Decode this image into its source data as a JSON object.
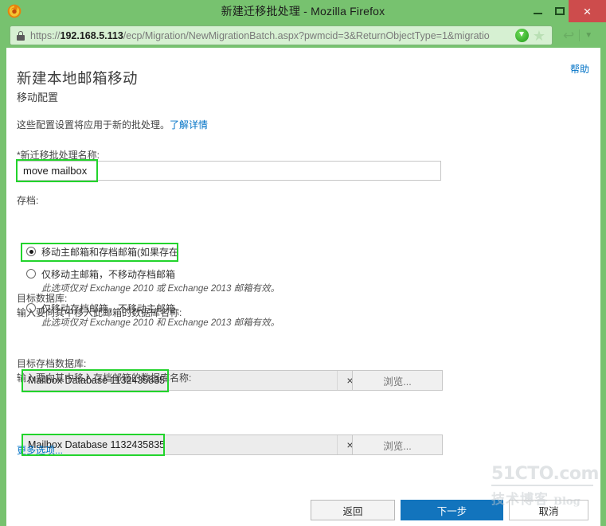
{
  "window": {
    "title": "新建迁移批处理 - Mozilla Firefox",
    "app_icon": "firefox-icon",
    "minimize_label": "–",
    "maximize_label": "□",
    "close_label": "×"
  },
  "browser": {
    "url_prefix": "https://",
    "url_host": "192.168.5.113",
    "url_path": "/ecp/Migration/NewMigrationBatch.aspx?pwmcid=3&ReturnObjectType=1&migratio",
    "lock_icon": "lock-icon",
    "download_icon": "download-arrow-icon",
    "bookmark_icon": "star-icon",
    "back_icon": "back-arrow-icon",
    "chevron_icon": "chevron-down-icon"
  },
  "page": {
    "help_link": "帮助",
    "title": "新建本地邮箱移动",
    "subtitle": "移动配置",
    "intro_text": "这些配置设置将应用于新的批处理。",
    "intro_link": "了解详情",
    "batch_name": {
      "label": "*新迁移批处理名称:",
      "value": "move mailbox",
      "placeholder": ""
    },
    "archive": {
      "label": "存档:",
      "options": [
        {
          "label": "移动主邮箱和存档邮箱(如果存在",
          "selected": true,
          "note": ""
        },
        {
          "label": "仅移动主邮箱，不移动存档邮箱",
          "selected": false,
          "note": "此选项仅对 Exchange 2010 或 Exchange 2013 邮箱有效。"
        },
        {
          "label": "仅移动存档邮箱，不移动主邮箱",
          "selected": false,
          "note": "此选项仅对 Exchange 2010 和 Exchange 2013 邮箱有效。"
        }
      ]
    },
    "target_db": {
      "label": "目标数据库:",
      "hint": "输入要向其中移入此邮箱的数据库名称:",
      "value": "Mailbox Database 1132435835",
      "clear_label": "×",
      "browse_label": "浏览..."
    },
    "target_archive_db": {
      "label": "目标存档数据库:",
      "hint": "输入要向其中移入存档邮箱的数据库名称:",
      "value": "Mailbox Database 1132435835",
      "clear_label": "×",
      "browse_label": "浏览..."
    },
    "more_options": "更多选项...",
    "buttons": {
      "back": "返回",
      "next": "下一步",
      "cancel": "取消"
    }
  },
  "watermark": {
    "main": "51CTO.com",
    "sub_cn": "技术博客",
    "sub_en": "Blog"
  },
  "colors": {
    "chrome_green": "#77c26f",
    "close_red": "#cd4c4c",
    "link_blue": "#0072c6",
    "primary_button": "#1274bd",
    "highlight_green": "#22d42c"
  }
}
